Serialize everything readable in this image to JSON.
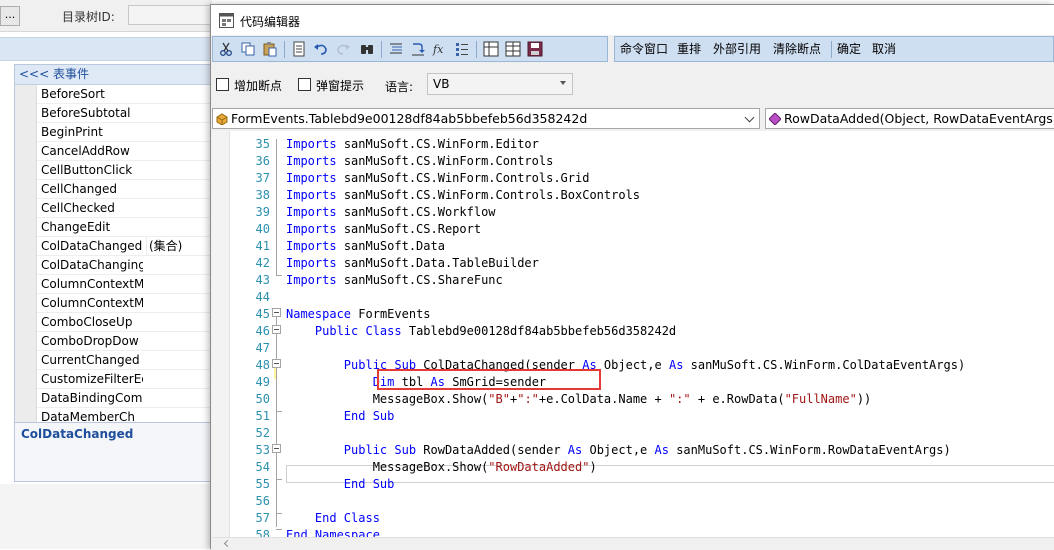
{
  "background_window": {
    "dots_button": "...",
    "dir_id_label": "目录树ID:",
    "events_panel": {
      "header": "<<< 表事件",
      "events": [
        {
          "name": "BeforeSort",
          "value": ""
        },
        {
          "name": "BeforeSubtotal",
          "value": ""
        },
        {
          "name": "BeginPrint",
          "value": ""
        },
        {
          "name": "CancelAddRow",
          "value": ""
        },
        {
          "name": "CellButtonClick",
          "value": ""
        },
        {
          "name": "CellChanged",
          "value": ""
        },
        {
          "name": "CellChecked",
          "value": ""
        },
        {
          "name": "ChangeEdit",
          "value": ""
        },
        {
          "name": "ColDataChanged",
          "value": "(集合)"
        },
        {
          "name": "ColDataChanging",
          "value": ""
        },
        {
          "name": "ColumnContextM",
          "value": ""
        },
        {
          "name": "ColumnContextM",
          "value": ""
        },
        {
          "name": "ComboCloseUp",
          "value": ""
        },
        {
          "name": "ComboDropDow",
          "value": ""
        },
        {
          "name": "CurrentChanged",
          "value": ""
        },
        {
          "name": "CustomizeFilterEc",
          "value": ""
        },
        {
          "name": "DataBindingComp",
          "value": ""
        },
        {
          "name": "DataMemberCh",
          "value": ""
        }
      ],
      "description_title": "ColDataChanged"
    }
  },
  "editor": {
    "title": "代码编辑器",
    "toolbar_right": [
      "命令窗口",
      "重排",
      "外部引用",
      "清除断点",
      "确定",
      "取消"
    ],
    "options": {
      "add_breakpoint_label": "增加断点",
      "add_breakpoint_checked": false,
      "popup_hint_label": "弹窗提示",
      "popup_hint_checked": false,
      "language_label": "语言:",
      "language_value": "VB"
    },
    "class_combo": "FormEvents.Tablebd9e00128df84ab5bbefeb56d358242d",
    "member_combo": "RowDataAdded(Object, RowDataEventArgs)",
    "code_lines": [
      {
        "n": "35",
        "t": [
          [
            "kw",
            "Imports"
          ],
          [
            "",
            "sanMuSoft.CS.WinForm.Editor"
          ]
        ]
      },
      {
        "n": "36",
        "t": [
          [
            "kw",
            "Imports"
          ],
          [
            "",
            "sanMuSoft.CS.WinForm.Controls"
          ]
        ]
      },
      {
        "n": "37",
        "t": [
          [
            "kw",
            "Imports"
          ],
          [
            "",
            "sanMuSoft.CS.WinForm.Controls.Grid"
          ]
        ]
      },
      {
        "n": "38",
        "t": [
          [
            "kw",
            "Imports"
          ],
          [
            "",
            "sanMuSoft.CS.WinForm.Controls.BoxControls"
          ]
        ]
      },
      {
        "n": "39",
        "t": [
          [
            "kw",
            "Imports"
          ],
          [
            "",
            "sanMuSoft.CS.Workflow"
          ]
        ]
      },
      {
        "n": "40",
        "t": [
          [
            "kw",
            "Imports"
          ],
          [
            "",
            "sanMuSoft.CS.Report"
          ]
        ]
      },
      {
        "n": "41",
        "t": [
          [
            "kw",
            "Imports"
          ],
          [
            "",
            "sanMuSoft.Data"
          ]
        ]
      },
      {
        "n": "42",
        "t": [
          [
            "kw",
            "Imports"
          ],
          [
            "",
            "sanMuSoft.Data.TableBuilder"
          ]
        ]
      },
      {
        "n": "43",
        "t": [
          [
            "kw",
            "Imports"
          ],
          [
            "",
            "sanMuSoft.CS.ShareFunc"
          ]
        ]
      },
      {
        "n": "44",
        "t": []
      },
      {
        "n": "45",
        "t": [
          [
            "kw",
            "Namespace"
          ],
          [
            "",
            "FormEvents"
          ]
        ]
      },
      {
        "n": "46",
        "t": [
          [
            "",
            "    "
          ],
          [
            "kw",
            "Public Class"
          ],
          [
            "",
            "Tablebd9e00128df84ab5bbefeb56d358242d"
          ]
        ]
      },
      {
        "n": "47",
        "t": []
      },
      {
        "n": "48",
        "t": [
          [
            "",
            "        "
          ],
          [
            "kw",
            "Public Sub"
          ],
          [
            "",
            "ColDataChanged(sender "
          ],
          [
            "kw",
            "As"
          ],
          [
            "",
            "Object"
          ],
          [
            "",
            ",e "
          ],
          [
            "kw",
            "As"
          ],
          [
            "",
            " sanMuSoft.CS.WinForm.ColDataEventArgs)"
          ]
        ]
      },
      {
        "n": "49",
        "t": [
          [
            "",
            "            "
          ],
          [
            "kw",
            "Dim"
          ],
          [
            "",
            "tbl "
          ],
          [
            "kw",
            "As"
          ],
          [
            "",
            "SmGrid=sender"
          ]
        ]
      },
      {
        "n": "50",
        "t": [
          [
            "",
            "            MessageBox.Show("
          ],
          [
            "str",
            "\"B\""
          ],
          [
            "",
            "+"
          ],
          [
            "str",
            "\":\""
          ],
          [
            "",
            "+e.ColData.Name + "
          ],
          [
            "str",
            "\":\""
          ],
          [
            "",
            " + e.RowData("
          ],
          [
            "str",
            "\"FullName\""
          ],
          [
            "",
            "))"
          ]
        ]
      },
      {
        "n": "51",
        "t": [
          [
            "",
            "        "
          ],
          [
            "kw",
            "End Sub"
          ]
        ]
      },
      {
        "n": "52",
        "t": []
      },
      {
        "n": "53",
        "t": [
          [
            "",
            "        "
          ],
          [
            "kw",
            "Public Sub"
          ],
          [
            "",
            "RowDataAdded(sender "
          ],
          [
            "kw",
            "As"
          ],
          [
            "",
            "Object"
          ],
          [
            "",
            ",e "
          ],
          [
            "kw",
            "As"
          ],
          [
            "",
            " sanMuSoft.CS.WinForm.RowDataEventArgs)"
          ]
        ]
      },
      {
        "n": "54",
        "t": [
          [
            "",
            "            MessageBox.Show("
          ],
          [
            "str",
            "\"RowDataAdded\""
          ],
          [
            "",
            ")"
          ]
        ]
      },
      {
        "n": "55",
        "t": [
          [
            "",
            "        "
          ],
          [
            "kw",
            "End Sub"
          ]
        ]
      },
      {
        "n": "56",
        "t": []
      },
      {
        "n": "57",
        "t": [
          [
            "",
            "    "
          ],
          [
            "kw",
            "End Class"
          ]
        ]
      },
      {
        "n": "58",
        "t": [
          [
            "kw",
            "End Namespace"
          ]
        ]
      }
    ]
  }
}
